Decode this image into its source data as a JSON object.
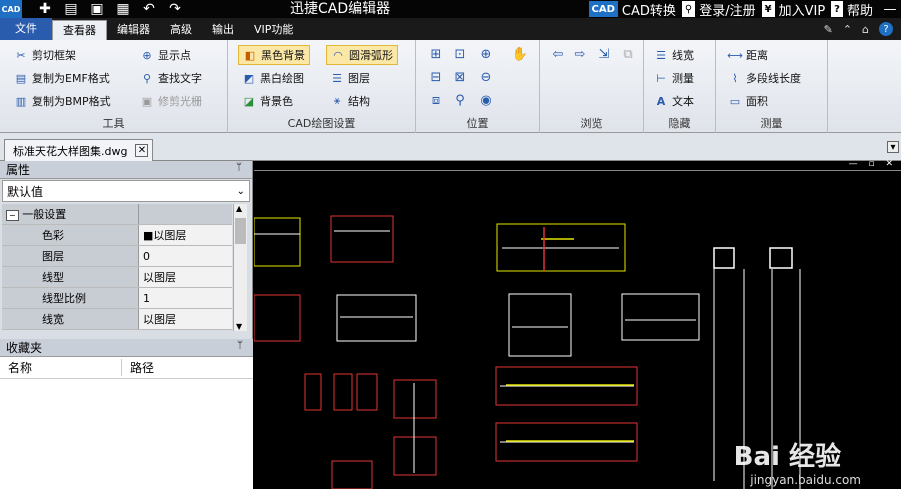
{
  "window": {
    "title": "迅捷CAD编辑器",
    "app_logo": "CAD",
    "quick_icons": [
      "new-icon",
      "open-icon",
      "save-icon",
      "save-as-icon",
      "undo-icon",
      "redo-icon"
    ],
    "right_items": [
      {
        "badge": "CAD",
        "label": "CAD转换"
      },
      {
        "badge": "⚲",
        "label": "登录/注册"
      },
      {
        "badge": "¥",
        "label": "加入VIP"
      },
      {
        "badge": "?",
        "label": "帮助"
      }
    ]
  },
  "menu": {
    "file": "文件",
    "tabs": [
      "查看器",
      "编辑器",
      "高级",
      "输出",
      "VIP功能"
    ],
    "active": "查看器"
  },
  "ribbon": {
    "tools": {
      "label": "工具",
      "items": [
        "剪切框架",
        "复制为EMF格式",
        "复制为BMP格式",
        "显示点",
        "查找文字",
        "修剪光栅"
      ]
    },
    "cad_settings": {
      "label": "CAD绘图设置",
      "items": [
        "黑色背景",
        "黑白绘图",
        "背景色",
        "圆滑弧形",
        "图层",
        "结构"
      ]
    },
    "position": {
      "label": "位置"
    },
    "browse": {
      "label": "浏览"
    },
    "hide": {
      "label": "隐藏",
      "items": [
        "线宽",
        "测量",
        "文本"
      ]
    },
    "measure": {
      "label": "测量",
      "items": [
        "距离",
        "多段线长度",
        "面积"
      ]
    }
  },
  "document": {
    "tab_name": "标准天花大样图集.dwg",
    "tab_close": "✕"
  },
  "properties": {
    "header": "属性",
    "pin": "ᛘ",
    "selected": "默认值",
    "category": "一般设置",
    "rows": [
      {
        "key": "色彩",
        "value": "■以图层"
      },
      {
        "key": "图层",
        "value": "0"
      },
      {
        "key": "线型",
        "value": "以图层"
      },
      {
        "key": "线型比例",
        "value": "1"
      },
      {
        "key": "线宽",
        "value": "以图层"
      }
    ]
  },
  "favorites": {
    "header": "收藏夹",
    "pin": "ᛘ",
    "col_name": "名称",
    "col_path": "路径"
  },
  "watermark": {
    "brand": "Bai 经验",
    "url": "jingyan.baidu.com"
  }
}
